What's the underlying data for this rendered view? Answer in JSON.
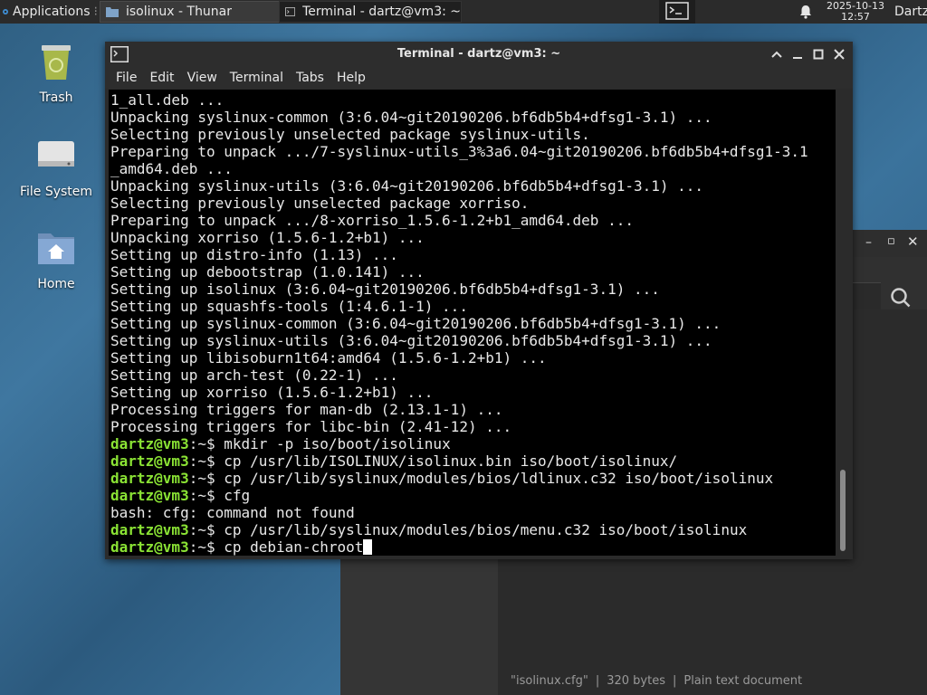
{
  "panel": {
    "applications_label": "Applications",
    "tasks": [
      {
        "label": "isolinux - Thunar"
      },
      {
        "label": "Terminal - dartz@vm3: ~"
      }
    ],
    "clock": {
      "date": "2025-10-13",
      "time": "12:57"
    },
    "user": "Dartz"
  },
  "desktop": {
    "icons": [
      {
        "label": "Trash"
      },
      {
        "label": "File System"
      },
      {
        "label": "Home"
      }
    ]
  },
  "thunar": {
    "status": {
      "file": "\"isolinux.cfg\"",
      "size": "320 bytes",
      "type": "Plain text document",
      "sep": "|"
    }
  },
  "terminal": {
    "title": "Terminal - dartz@vm3: ~",
    "menu": [
      "File",
      "Edit",
      "View",
      "Terminal",
      "Tabs",
      "Help"
    ],
    "prompt_user": "dartz@vm3",
    "prompt_path": ":~$",
    "output": [
      "1_all.deb ...",
      "Unpacking syslinux-common (3:6.04~git20190206.bf6db5b4+dfsg1-3.1) ...",
      "Selecting previously unselected package syslinux-utils.",
      "Preparing to unpack .../7-syslinux-utils_3%3a6.04~git20190206.bf6db5b4+dfsg1-3.1",
      "_amd64.deb ...",
      "Unpacking syslinux-utils (3:6.04~git20190206.bf6db5b4+dfsg1-3.1) ...",
      "Selecting previously unselected package xorriso.",
      "Preparing to unpack .../8-xorriso_1.5.6-1.2+b1_amd64.deb ...",
      "Unpacking xorriso (1.5.6-1.2+b1) ...",
      "Setting up distro-info (1.13) ...",
      "Setting up debootstrap (1.0.141) ...",
      "Setting up isolinux (3:6.04~git20190206.bf6db5b4+dfsg1-3.1) ...",
      "Setting up squashfs-tools (1:4.6.1-1) ...",
      "Setting up syslinux-common (3:6.04~git20190206.bf6db5b4+dfsg1-3.1) ...",
      "Setting up syslinux-utils (3:6.04~git20190206.bf6db5b4+dfsg1-3.1) ...",
      "Setting up libisoburn1t64:amd64 (1.5.6-1.2+b1) ...",
      "Setting up arch-test (0.22-1) ...",
      "Setting up xorriso (1.5.6-1.2+b1) ...",
      "Processing triggers for man-db (2.13.1-1) ...",
      "Processing triggers for libc-bin (2.41-12) ..."
    ],
    "commands": [
      {
        "cmd": " mkdir -p iso/boot/isolinux",
        "prompt": true
      },
      {
        "cmd": " cp /usr/lib/ISOLINUX/isolinux.bin iso/boot/isolinux/",
        "prompt": true
      },
      {
        "cmd": " cp /usr/lib/syslinux/modules/bios/ldlinux.c32 iso/boot/isolinux",
        "prompt": true
      },
      {
        "cmd": " cfg",
        "prompt": true
      },
      {
        "cmd": "bash: cfg: command not found",
        "prompt": false
      },
      {
        "cmd": " cp /usr/lib/syslinux/modules/bios/menu.c32 iso/boot/isolinux",
        "prompt": true
      },
      {
        "cmd": " cp debian-chroot",
        "prompt": true,
        "current": true
      }
    ]
  }
}
